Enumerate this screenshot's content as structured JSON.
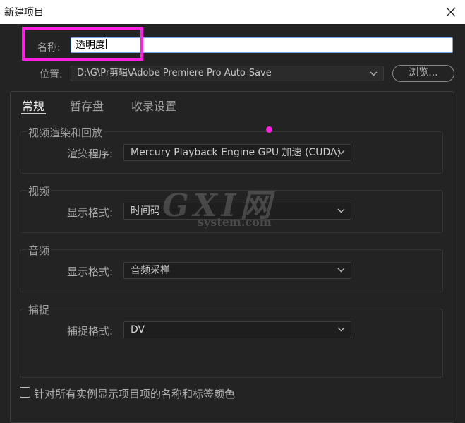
{
  "window": {
    "title": "新建项目"
  },
  "name_field": {
    "label": "名称:",
    "value": "透明度"
  },
  "location": {
    "label": "位置:",
    "value": "D:\\G\\Pr剪辑\\Adobe Premiere Pro Auto-Save",
    "browse_label": "浏览..."
  },
  "tabs": [
    {
      "label": "常规",
      "active": true
    },
    {
      "label": "暂存盘",
      "active": false
    },
    {
      "label": "收录设置",
      "active": false
    }
  ],
  "sections": {
    "render": {
      "title": "视频渲染和回放",
      "field_label": "渲染程序:",
      "value": "Mercury Playback Engine GPU 加速 (CUDA)"
    },
    "video": {
      "title": "视频",
      "field_label": "显示格式:",
      "value": "时间码"
    },
    "audio": {
      "title": "音频",
      "field_label": "显示格式:",
      "value": "音频采样"
    },
    "capture": {
      "title": "捕捉",
      "field_label": "捕捉格式:",
      "value": "DV"
    }
  },
  "checkbox": {
    "label": "针对所有实例显示项目项的名称和标签颜色",
    "checked": false
  },
  "watermark": {
    "big": "GXI网",
    "small": "system.com"
  },
  "colors": {
    "background": "#232323",
    "highlight": "#ff1fe0",
    "input_border": "#7aa6e6"
  }
}
